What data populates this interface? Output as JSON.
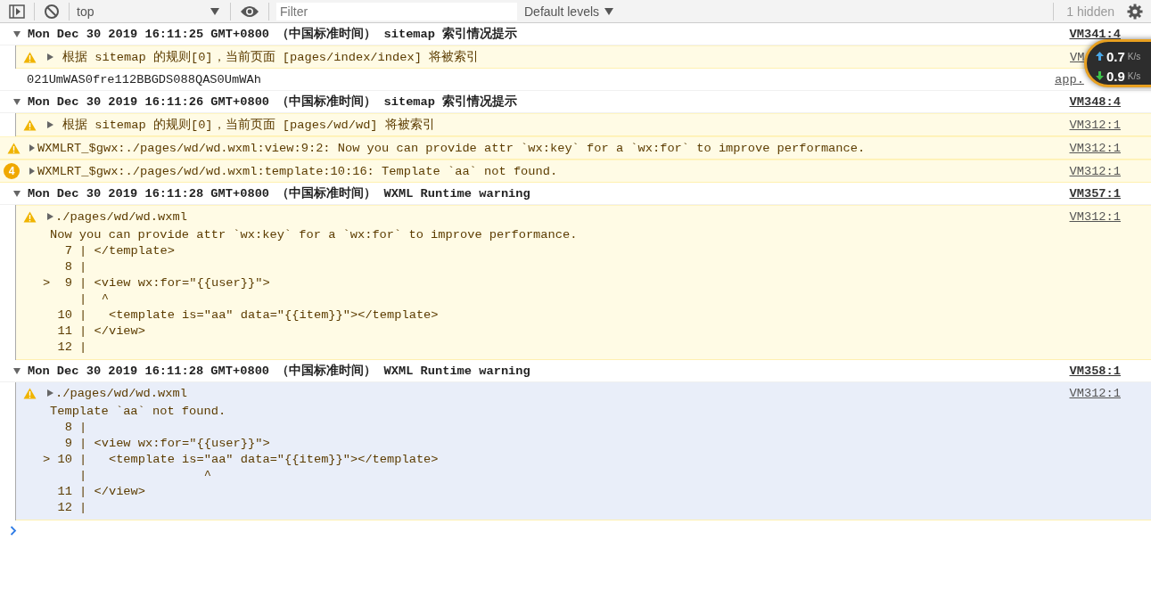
{
  "toolbar": {
    "context": "top",
    "filter_placeholder": "Filter",
    "levels": "Default levels",
    "hidden": "1 hidden"
  },
  "entries": [
    {
      "kind": "group",
      "expanded": true,
      "text": "Mon Dec 30 2019 16:11:25 GMT+0800 （中国标准时间） sitemap 索引情况提示",
      "source": "VM341:4",
      "children": [
        {
          "expanded": false,
          "highlighted": false,
          "text": "根据 sitemap 的规则[0]，当前页面 [pages/index/index] 将被索引",
          "source": "VM"
        }
      ]
    },
    {
      "kind": "log",
      "text": "021UmWAS0fre112BBGDS088QAS0UmWAh",
      "source": "app."
    },
    {
      "kind": "group",
      "expanded": true,
      "text": "Mon Dec 30 2019 16:11:26 GMT+0800 （中国标准时间） sitemap 索引情况提示",
      "source": "VM348:4",
      "children": [
        {
          "expanded": false,
          "highlighted": false,
          "text": "根据 sitemap 的规则[0]，当前页面 [pages/wd/wd] 将被索引",
          "source": "VM312:1"
        }
      ]
    },
    {
      "kind": "warning",
      "expanded": false,
      "highlighted": false,
      "text": "WXMLRT_$gwx:./pages/wd/wd.wxml:view:9:2: Now you can provide attr `wx:key` for a `wx:for` to improve performance.",
      "source": "VM312:1"
    },
    {
      "kind": "warning",
      "expanded": false,
      "highlighted": false,
      "count": "4",
      "text": "WXMLRT_$gwx:./pages/wd/wd.wxml:template:10:16: Template `aa` not found.",
      "source": "VM312:1"
    },
    {
      "kind": "group",
      "expanded": true,
      "text": "Mon Dec 30 2019 16:11:28 GMT+0800 （中国标准时间） WXML Runtime warning",
      "source": "VM357:1",
      "children": [
        {
          "expanded": false,
          "highlighted": false,
          "text": "./pages/wd/wd.wxml",
          "source": "VM312:1",
          "detail": "Now you can provide attr `wx:key` for a `wx:for` to improve performance.",
          "code": [
            "   7 | </template>",
            "   8 |",
            ">  9 | <view wx:for=\"{{user}}\">",
            "     |  ^",
            "  10 |   <template is=\"aa\" data=\"{{item}}\"></template>",
            "  11 | </view>",
            "  12 |"
          ]
        }
      ]
    },
    {
      "kind": "group",
      "expanded": true,
      "text": "Mon Dec 30 2019 16:11:28 GMT+0800 （中国标准时间） WXML Runtime warning",
      "source": "VM358:1",
      "children": [
        {
          "expanded": false,
          "highlighted": true,
          "text": "./pages/wd/wd.wxml",
          "source": "VM312:1",
          "detail": "Template `aa` not found.",
          "code": [
            "   8 |",
            "   9 | <view wx:for=\"{{user}}\">",
            "> 10 |   <template is=\"aa\" data=\"{{item}}\"></template>",
            "     |                ^",
            "  11 | </view>",
            "  12 |"
          ]
        }
      ]
    }
  ],
  "speed": {
    "up": "0.7",
    "up_unit": "K/s",
    "down": "0.9",
    "down_unit": "K/s"
  }
}
